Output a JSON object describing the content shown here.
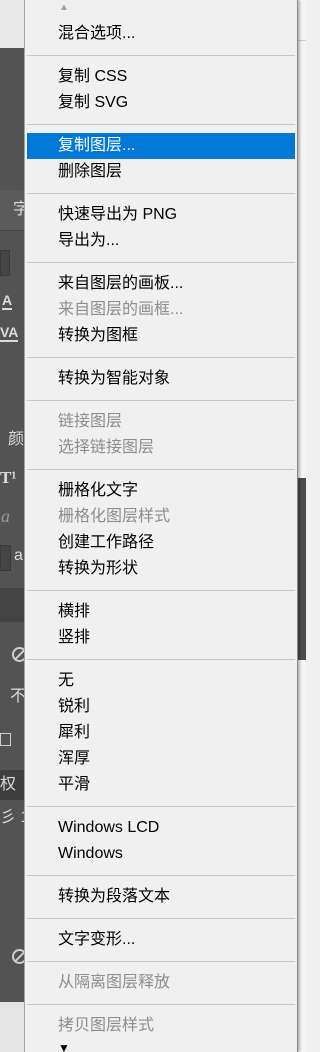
{
  "menu": {
    "highlight_color": "#0078d7",
    "disabled_text_color": "#8d8d8d",
    "scroll_up_icon": "triangle-up-icon",
    "scroll_down_icon": "triangle-down-icon",
    "scroll_up_glyph": "▲",
    "scroll_down_glyph": "▼",
    "groups": [
      {
        "items": [
          {
            "label": "混合选项...",
            "enabled": true
          }
        ]
      },
      {
        "items": [
          {
            "label": "复制 CSS",
            "enabled": true
          },
          {
            "label": "复制 SVG",
            "enabled": true
          }
        ]
      },
      {
        "items": [
          {
            "label": "复制图层...",
            "enabled": true,
            "highlighted": true
          },
          {
            "label": "删除图层",
            "enabled": true
          }
        ]
      },
      {
        "items": [
          {
            "label": "快速导出为 PNG",
            "enabled": true
          },
          {
            "label": "导出为...",
            "enabled": true
          }
        ]
      },
      {
        "items": [
          {
            "label": "来自图层的画板...",
            "enabled": true
          },
          {
            "label": "来自图层的画框...",
            "enabled": false
          },
          {
            "label": "转换为图框",
            "enabled": true
          }
        ]
      },
      {
        "items": [
          {
            "label": "转换为智能对象",
            "enabled": true
          }
        ]
      },
      {
        "items": [
          {
            "label": "链接图层",
            "enabled": false
          },
          {
            "label": "选择链接图层",
            "enabled": false
          }
        ]
      },
      {
        "items": [
          {
            "label": "栅格化文字",
            "enabled": true
          },
          {
            "label": "栅格化图层样式",
            "enabled": false
          },
          {
            "label": "创建工作路径",
            "enabled": true
          },
          {
            "label": "转换为形状",
            "enabled": true
          }
        ]
      },
      {
        "items": [
          {
            "label": "横排",
            "enabled": true
          },
          {
            "label": "竖排",
            "enabled": true
          }
        ]
      },
      {
        "items": [
          {
            "label": "无",
            "enabled": true
          },
          {
            "label": "锐利",
            "enabled": true
          },
          {
            "label": "犀利",
            "enabled": true
          },
          {
            "label": "浑厚",
            "enabled": true
          },
          {
            "label": "平滑",
            "enabled": true
          }
        ]
      },
      {
        "items": [
          {
            "label": "Windows LCD",
            "enabled": true
          },
          {
            "label": "Windows",
            "enabled": true
          }
        ]
      },
      {
        "items": [
          {
            "label": "转换为段落文本",
            "enabled": true
          }
        ]
      },
      {
        "items": [
          {
            "label": "文字变形...",
            "enabled": true
          }
        ]
      },
      {
        "items": [
          {
            "label": "从隔离图层释放",
            "enabled": false
          }
        ]
      },
      {
        "items": [
          {
            "label": "拷贝图层样式",
            "enabled": false
          }
        ]
      }
    ]
  },
  "left_panel": {
    "character_tab_label": "字",
    "tracking_icon_text": "A",
    "kerning_icon_text": "VA",
    "color_label": "颜",
    "superscript_icon_text": "T¹",
    "antialias_icon_text": "a",
    "antialias_value": "a",
    "opacity_label": "不",
    "layer_row_label": "权",
    "layer_row_label_2": "彡 1",
    "icons": [
      "circle-slash-icon",
      "circle-slash-icon"
    ]
  }
}
